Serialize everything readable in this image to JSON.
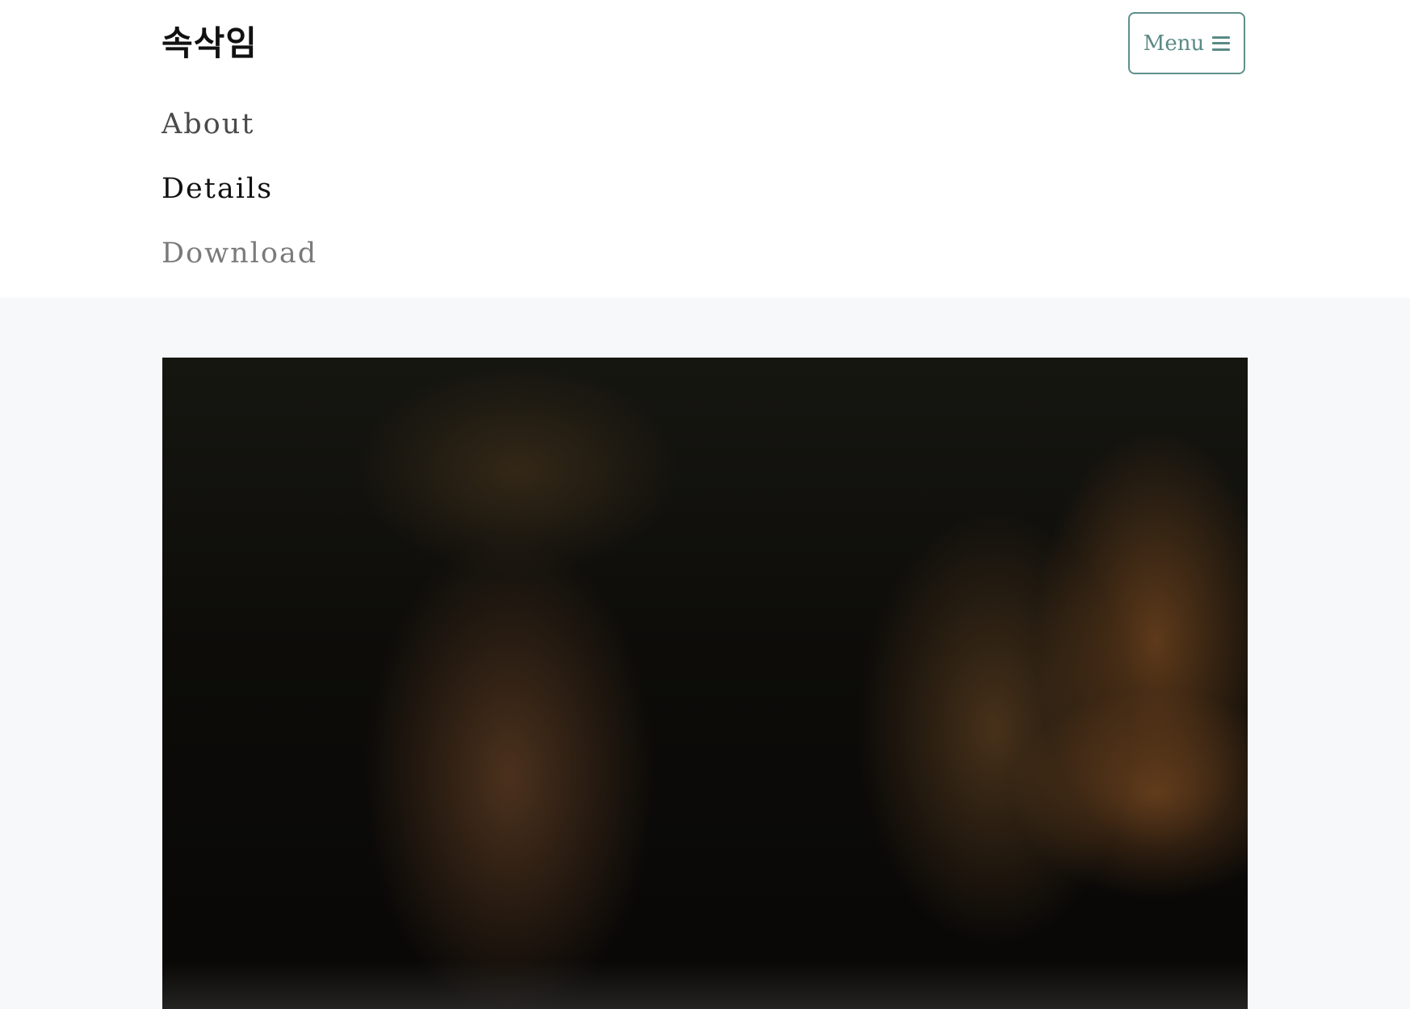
{
  "header": {
    "brand": "속삭임",
    "menu_label": "Menu"
  },
  "nav": {
    "about": "About",
    "details": "Details",
    "download": "Download"
  },
  "hero": {
    "image_icon": "photo-image"
  }
}
